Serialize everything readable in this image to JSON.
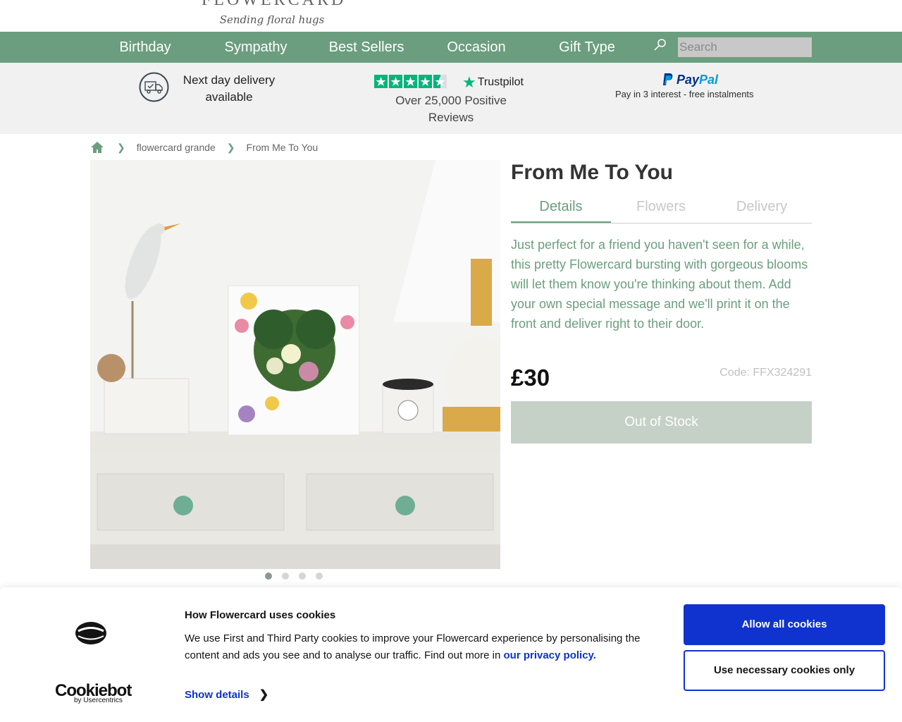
{
  "header": {
    "brand": "FLOWERCARD",
    "tagline": "Sending floral hugs"
  },
  "nav": {
    "items": [
      {
        "label": "Birthday"
      },
      {
        "label": "Sympathy"
      },
      {
        "label": "Best Sellers"
      },
      {
        "label": "Occasion"
      },
      {
        "label": "Gift Type"
      }
    ],
    "search_placeholder": "Search",
    "color": "#6b9e7e"
  },
  "usp": {
    "delivery": "Next day delivery available",
    "trustpilot_brand": "Trustpilot",
    "trustpilot_rating_stars": 4.5,
    "reviews": "Over 25,000 Positive Reviews",
    "paypal_brand_1": "Pay",
    "paypal_brand_2": "Pal",
    "paypal_text": "Pay in 3 interest - free instalments"
  },
  "breadcrumb": {
    "items": [
      "flowercard grande",
      "From Me To You"
    ]
  },
  "gallery": {
    "slides": 4,
    "active": 1
  },
  "product": {
    "title": "From Me To You",
    "tabs": [
      {
        "label": "Details",
        "active": true
      },
      {
        "label": "Flowers",
        "active": false
      },
      {
        "label": "Delivery",
        "active": false
      }
    ],
    "description": "Just perfect for a friend you haven't seen for a while, this pretty Flowercard bursting with gorgeous blooms will let them know you're thinking about them. Add your own special message and we'll print it on the front and deliver right to their door.",
    "price": "£30",
    "code": "Code: FFX324291",
    "stock_button": "Out of Stock"
  },
  "cookies": {
    "brand": "Cookiebot",
    "brand_sub": "by Usercentrics",
    "title": "How Flowercard uses cookies",
    "text": "We use First and Third Party cookies to improve your Flowercard experience by personalising the content and ads you see and to analyse our traffic. Find out more in ",
    "link": "our privacy policy.",
    "show_details": "Show details",
    "allow_all": "Allow all cookies",
    "necessary_only": "Use necessary cookies only",
    "accent": "#1032cf"
  }
}
